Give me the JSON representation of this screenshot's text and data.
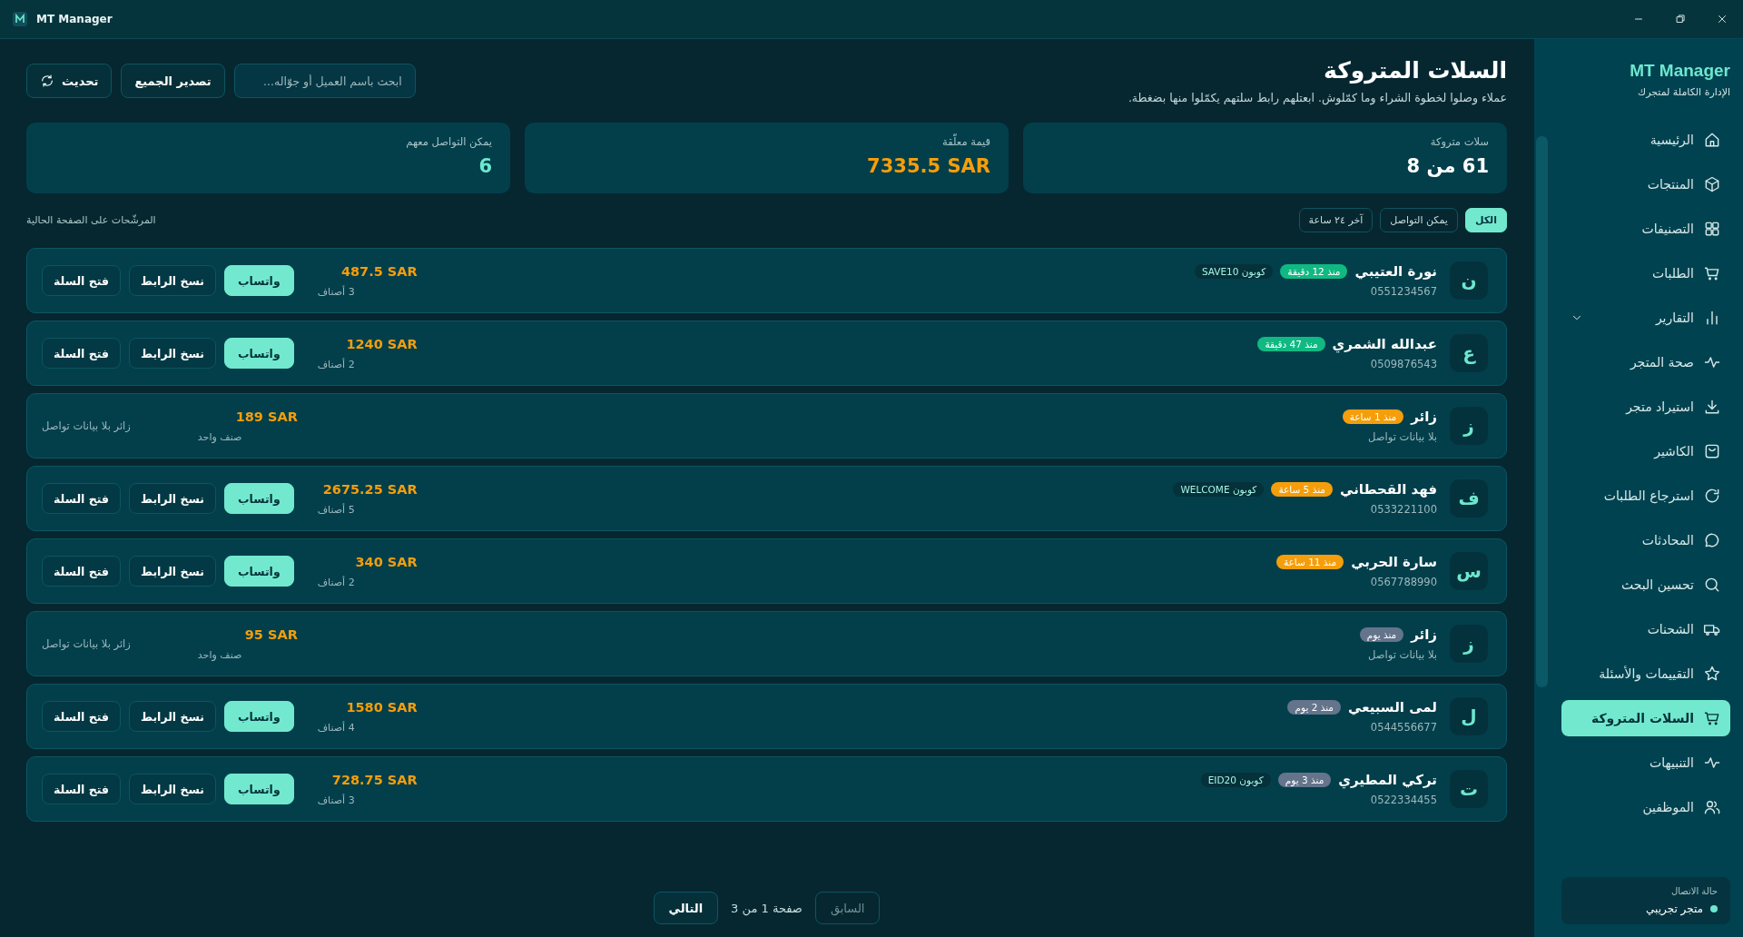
{
  "window": {
    "title": "MT Manager"
  },
  "sidebar": {
    "brand": "MT Manager",
    "tagline": "الإدارة الكاملة لمتجرك",
    "items": [
      {
        "label": "الرئيسية",
        "selected": false,
        "kind": "link"
      },
      {
        "label": "المنتجات",
        "selected": false,
        "kind": "link"
      },
      {
        "label": "التصنيفات",
        "selected": false,
        "kind": "link"
      },
      {
        "label": "الطلبات",
        "selected": false,
        "kind": "link"
      },
      {
        "label": "التقارير",
        "selected": false,
        "kind": "group",
        "expanded": false
      },
      {
        "label": "صحة المتجر",
        "selected": false,
        "kind": "link"
      },
      {
        "label": "استيراد متجر",
        "selected": false,
        "kind": "link"
      },
      {
        "label": "الكاشير",
        "selected": false,
        "kind": "link"
      },
      {
        "label": "استرجاع الطلبات",
        "selected": false,
        "kind": "link"
      },
      {
        "label": "المحادثات",
        "selected": false,
        "kind": "link"
      },
      {
        "label": "تحسين البحث",
        "selected": false,
        "kind": "link"
      },
      {
        "label": "الشحنات",
        "selected": false,
        "kind": "link"
      },
      {
        "label": "التقييمات والأسئلة",
        "selected": false,
        "kind": "link"
      },
      {
        "label": "السلات المتروكة",
        "selected": true,
        "kind": "link"
      },
      {
        "label": "التنبيهات",
        "selected": false,
        "kind": "link"
      },
      {
        "label": "الموظفين",
        "selected": false,
        "kind": "link"
      }
    ],
    "status": {
      "label": "حالة الاتصال",
      "value": "متجر تجريبي"
    }
  },
  "header": {
    "title": "السلات المتروكة",
    "subtitle": "عملاء وصلوا لخطوة الشراء وما كمّلوش. ابعتلهم رابط سلتهم يكمّلوا منها بضغطة.",
    "search": {
      "placeholder": "ابحث باسم العميل أو جوّاله..."
    },
    "export_button": "تصدير الجميع",
    "refresh_button": "تحديث"
  },
  "stats": [
    {
      "label": "سلات متروكة",
      "value": "61 من 8",
      "color": "#ffffff"
    },
    {
      "label": "قيمة معلّقة",
      "value": "7335.5 SAR",
      "color": "#f59e0b"
    },
    {
      "label": "يمكن التواصل معهم",
      "value": "6",
      "color": "#6ee7cf"
    }
  ],
  "filters": [
    {
      "label": "الكل",
      "selected": true
    },
    {
      "label": "يمكن التواصل",
      "selected": false
    },
    {
      "label": "آخر ٢٤ ساعة",
      "selected": false
    }
  ],
  "filters_note": "المرشّحات على الصفحة الحالية",
  "rows": [
    {
      "kind": "contact",
      "initial": "ن",
      "name": "نورة العتيبي",
      "age": {
        "text": "منذ 12 دقيقة",
        "color": "#10b981"
      },
      "coupon": "كوبون SAVE10",
      "phone": "0551234567",
      "total": "487.5 SAR",
      "items": "3 أصناف",
      "actions": [
        "واتساب",
        "نسخ الرابط",
        "فتح السلة"
      ]
    },
    {
      "kind": "contact",
      "initial": "ع",
      "name": "عبدالله الشمري",
      "age": {
        "text": "منذ 47 دقيقة",
        "color": "#10b981"
      },
      "phone": "0509876543",
      "total": "1240 SAR",
      "items": "2 أصناف",
      "actions": [
        "واتساب",
        "نسخ الرابط",
        "فتح السلة"
      ]
    },
    {
      "kind": "visitor",
      "initial": "ز",
      "name": "زائر",
      "age": {
        "text": "منذ 1 ساعة",
        "color": "#f59e0b"
      },
      "phone": "بلا بيانات تواصل",
      "total": "189 SAR",
      "items": "صنف واحد",
      "note": "زائر بلا بيانات تواصل"
    },
    {
      "kind": "contact",
      "initial": "ف",
      "name": "فهد القحطاني",
      "age": {
        "text": "منذ 5 ساعة",
        "color": "#f59e0b"
      },
      "coupon": "كوبون WELCOME",
      "phone": "0533221100",
      "total": "2675.25 SAR",
      "items": "5 أصناف",
      "actions": [
        "واتساب",
        "نسخ الرابط",
        "فتح السلة"
      ]
    },
    {
      "kind": "contact",
      "initial": "س",
      "name": "سارة الحربي",
      "age": {
        "text": "منذ 11 ساعة",
        "color": "#f59e0b"
      },
      "phone": "0567788990",
      "total": "340 SAR",
      "items": "2 أصناف",
      "actions": [
        "واتساب",
        "نسخ الرابط",
        "فتح السلة"
      ]
    },
    {
      "kind": "visitor",
      "initial": "ز",
      "name": "زائر",
      "age": {
        "text": "منذ يوم",
        "color": "#64748b"
      },
      "phone": "بلا بيانات تواصل",
      "total": "95 SAR",
      "items": "صنف واحد",
      "note": "زائر بلا بيانات تواصل"
    },
    {
      "kind": "contact",
      "initial": "ل",
      "name": "لمى السبيعي",
      "age": {
        "text": "منذ 2 يوم",
        "color": "#64748b"
      },
      "phone": "0544556677",
      "total": "1580 SAR",
      "items": "4 أصناف",
      "actions": [
        "واتساب",
        "نسخ الرابط",
        "فتح السلة"
      ]
    },
    {
      "kind": "contact",
      "initial": "ت",
      "name": "تركي المطيري",
      "age": {
        "text": "منذ 3 يوم",
        "color": "#64748b"
      },
      "coupon": "كوبون EID20",
      "phone": "0522334455",
      "total": "728.75 SAR",
      "items": "3 أصناف",
      "actions": [
        "واتساب",
        "نسخ الرابط",
        "فتح السلة"
      ]
    }
  ],
  "pager": {
    "prev": {
      "label": "السابق",
      "disabled": true
    },
    "info": "صفحة 1 من 3",
    "next": {
      "label": "التالي",
      "disabled": false
    }
  }
}
